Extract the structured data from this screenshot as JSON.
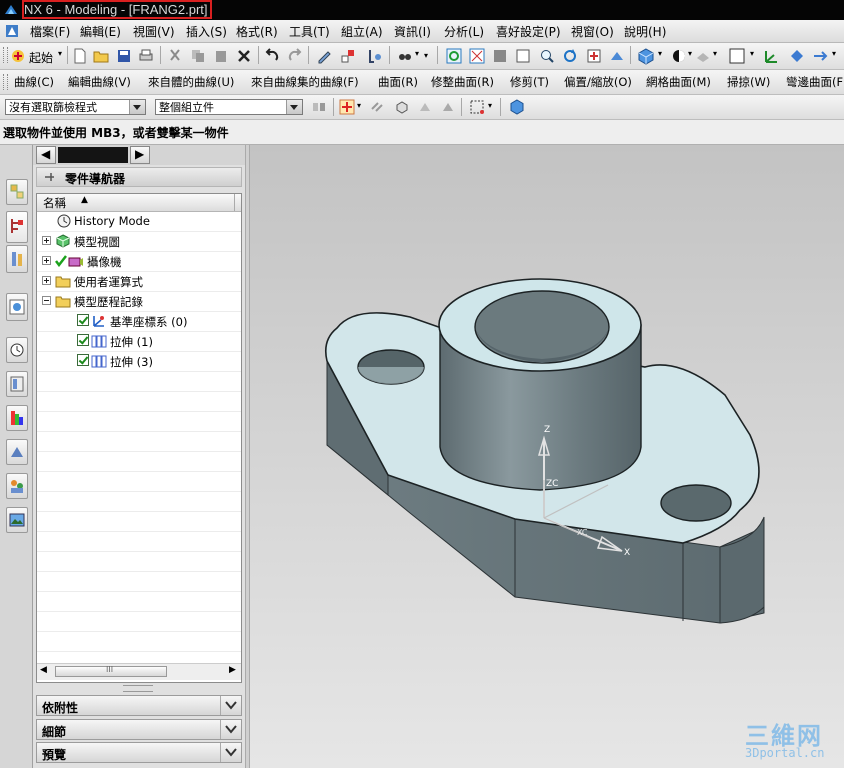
{
  "window": {
    "title": "NX 6 - Modeling - [FRANG2.prt]"
  },
  "menu": [
    {
      "label": "檔案(F)"
    },
    {
      "label": "編輯(E)"
    },
    {
      "label": "視圖(V)"
    },
    {
      "label": "插入(S)"
    },
    {
      "label": "格式(R)"
    },
    {
      "label": "工具(T)"
    },
    {
      "label": "組立(A)"
    },
    {
      "label": "資訊(I)"
    },
    {
      "label": "分析(L)"
    },
    {
      "label": "喜好設定(P)"
    },
    {
      "label": "視窗(O)"
    },
    {
      "label": "說明(H)"
    }
  ],
  "standard_toolbar": {
    "start_label": "起始"
  },
  "curve_toolbar": [
    {
      "label": "曲線(C)"
    },
    {
      "label": "編輯曲線(V)"
    },
    {
      "label": "來自體的曲線(U)"
    },
    {
      "label": "來自曲線集的曲線(F)"
    },
    {
      "label": "曲面(R)"
    },
    {
      "label": "修整曲面(R)"
    },
    {
      "label": "修剪(T)"
    },
    {
      "label": "偏置/縮放(O)"
    },
    {
      "label": "網格曲面(M)"
    },
    {
      "label": "掃掠(W)"
    },
    {
      "label": "彎邊曲面(F)"
    }
  ],
  "selection_bar": {
    "filter_value": "沒有選取篩檢程式",
    "scope_value": "整個組立件"
  },
  "cue_line": {
    "text": "選取物件並使用 MB3，或者雙擊某一物件"
  },
  "navigator": {
    "title": "零件導航器",
    "column_name": "名稱",
    "items": [
      {
        "label": "History Mode"
      },
      {
        "label": "模型視圖"
      },
      {
        "label": "攝像機"
      },
      {
        "label": "使用者運算式"
      },
      {
        "label": "模型歷程記錄"
      },
      {
        "label": "基準座標系 (0)"
      },
      {
        "label": "拉伸 (1)"
      },
      {
        "label": "拉伸 (3)"
      }
    ],
    "panels": [
      {
        "label": "依附性"
      },
      {
        "label": "細節"
      },
      {
        "label": "預覽"
      }
    ]
  },
  "triad": {
    "z_label": "Z",
    "zc_label": "ZC",
    "x_label": "X",
    "xc_label": "XC"
  },
  "watermark": {
    "cn_text": "三維网",
    "url_text": "3Dportal.cn"
  },
  "colors": {
    "title_bar": "#050505",
    "model_top": "#cfe6ea",
    "model_side": "#6f7e83",
    "accent_red": "#d92020"
  }
}
